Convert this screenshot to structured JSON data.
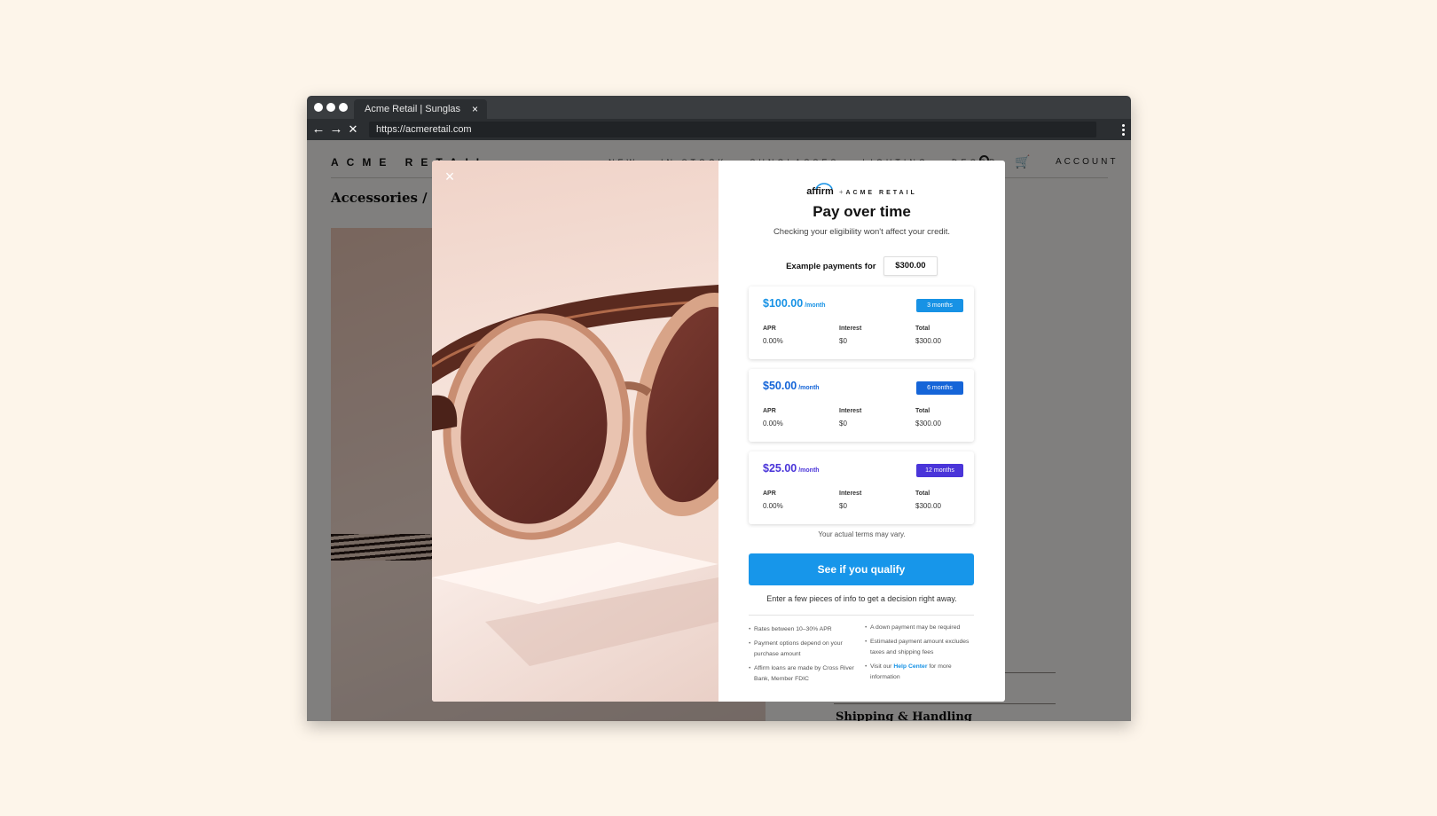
{
  "browser": {
    "tab_title": "Acme Retail | Sunglasses",
    "tab_close": "×",
    "url": "https://acmeretail.com",
    "nav": {
      "back": "←",
      "forward": "→",
      "stop": "✕"
    }
  },
  "site": {
    "brand": "ACME RETAIL",
    "nav_items": [
      "NEW",
      "IN STOCK",
      "SUNGLASSES",
      "LIGHTING",
      "DECOR"
    ],
    "account_label": "ACCOUNT",
    "breadcrumb": "Accessories / Sunglasses",
    "shipping_heading": "Shipping & Handling"
  },
  "modal": {
    "close_label": "×",
    "logo": {
      "affirm": "affirm",
      "plus": "+",
      "partner": "ACME RETAIL"
    },
    "heading": "Pay over time",
    "subheading": "Checking your eligibility won't affect your credit.",
    "amount_label": "Example payments for",
    "amount_value": "$300.00",
    "column_labels": {
      "apr": "APR",
      "interest": "Interest",
      "total": "Total"
    },
    "per_month": "/month",
    "plans": [
      {
        "price": "$100.00",
        "term": "3 months",
        "apr": "0.00%",
        "interest": "$0",
        "total": "$300.00",
        "price_color": "#1792e5",
        "badge_color": "#1792e5"
      },
      {
        "price": "$50.00",
        "term": "6 months",
        "apr": "0.00%",
        "interest": "$0",
        "total": "$300.00",
        "price_color": "#1565d8",
        "badge_color": "#1565d8"
      },
      {
        "price": "$25.00",
        "term": "12 months",
        "apr": "0.00%",
        "interest": "$0",
        "total": "$300.00",
        "price_color": "#4a35d9",
        "badge_color": "#4a35d9"
      }
    ],
    "terms_note": "Your actual terms may vary.",
    "cta_label": "See if you qualify",
    "cta_color": "#1796ea",
    "cta_sub": "Enter a few pieces of info to get a decision right away.",
    "bullets_left": [
      "Rates between 10–30% APR",
      "Payment options depend on your purchase amount",
      "Affirm loans are made by Cross River Bank, Member FDIC"
    ],
    "bullets_right": [
      "A down payment may be required",
      "Estimated payment amount excludes taxes and shipping fees"
    ],
    "help_prefix": "Visit our",
    "help_link": "Help Center",
    "help_suffix": "for more information"
  }
}
